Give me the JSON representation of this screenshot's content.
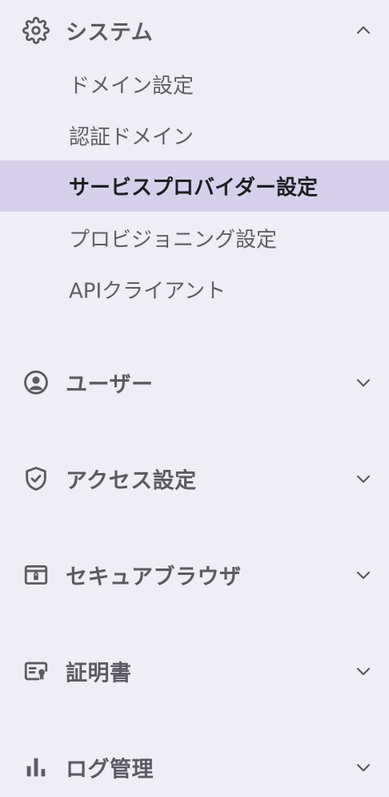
{
  "sidebar": {
    "system": {
      "label": "システム",
      "expanded": true,
      "items": [
        {
          "label": "ドメイン設定"
        },
        {
          "label": "認証ドメイン"
        },
        {
          "label": "サービスプロバイダー設定",
          "active": true
        },
        {
          "label": "プロビジョニング設定"
        },
        {
          "label": "APIクライアント"
        }
      ]
    },
    "users": {
      "label": "ユーザー",
      "expanded": false
    },
    "access": {
      "label": "アクセス設定",
      "expanded": false
    },
    "browser": {
      "label": "セキュアブラウザ",
      "expanded": false
    },
    "certs": {
      "label": "証明書",
      "expanded": false
    },
    "logs": {
      "label": "ログ管理",
      "expanded": false
    }
  },
  "colors": {
    "background": "#efeef5",
    "active_bg": "#d7d0ec",
    "text": "#5a5a61",
    "active_text": "#1f1f24"
  },
  "icons": {
    "system": "gear-icon",
    "users": "user-circle-icon",
    "access": "shield-check-icon",
    "browser": "secure-browser-icon",
    "certs": "certificate-icon",
    "logs": "bar-chart-icon"
  }
}
